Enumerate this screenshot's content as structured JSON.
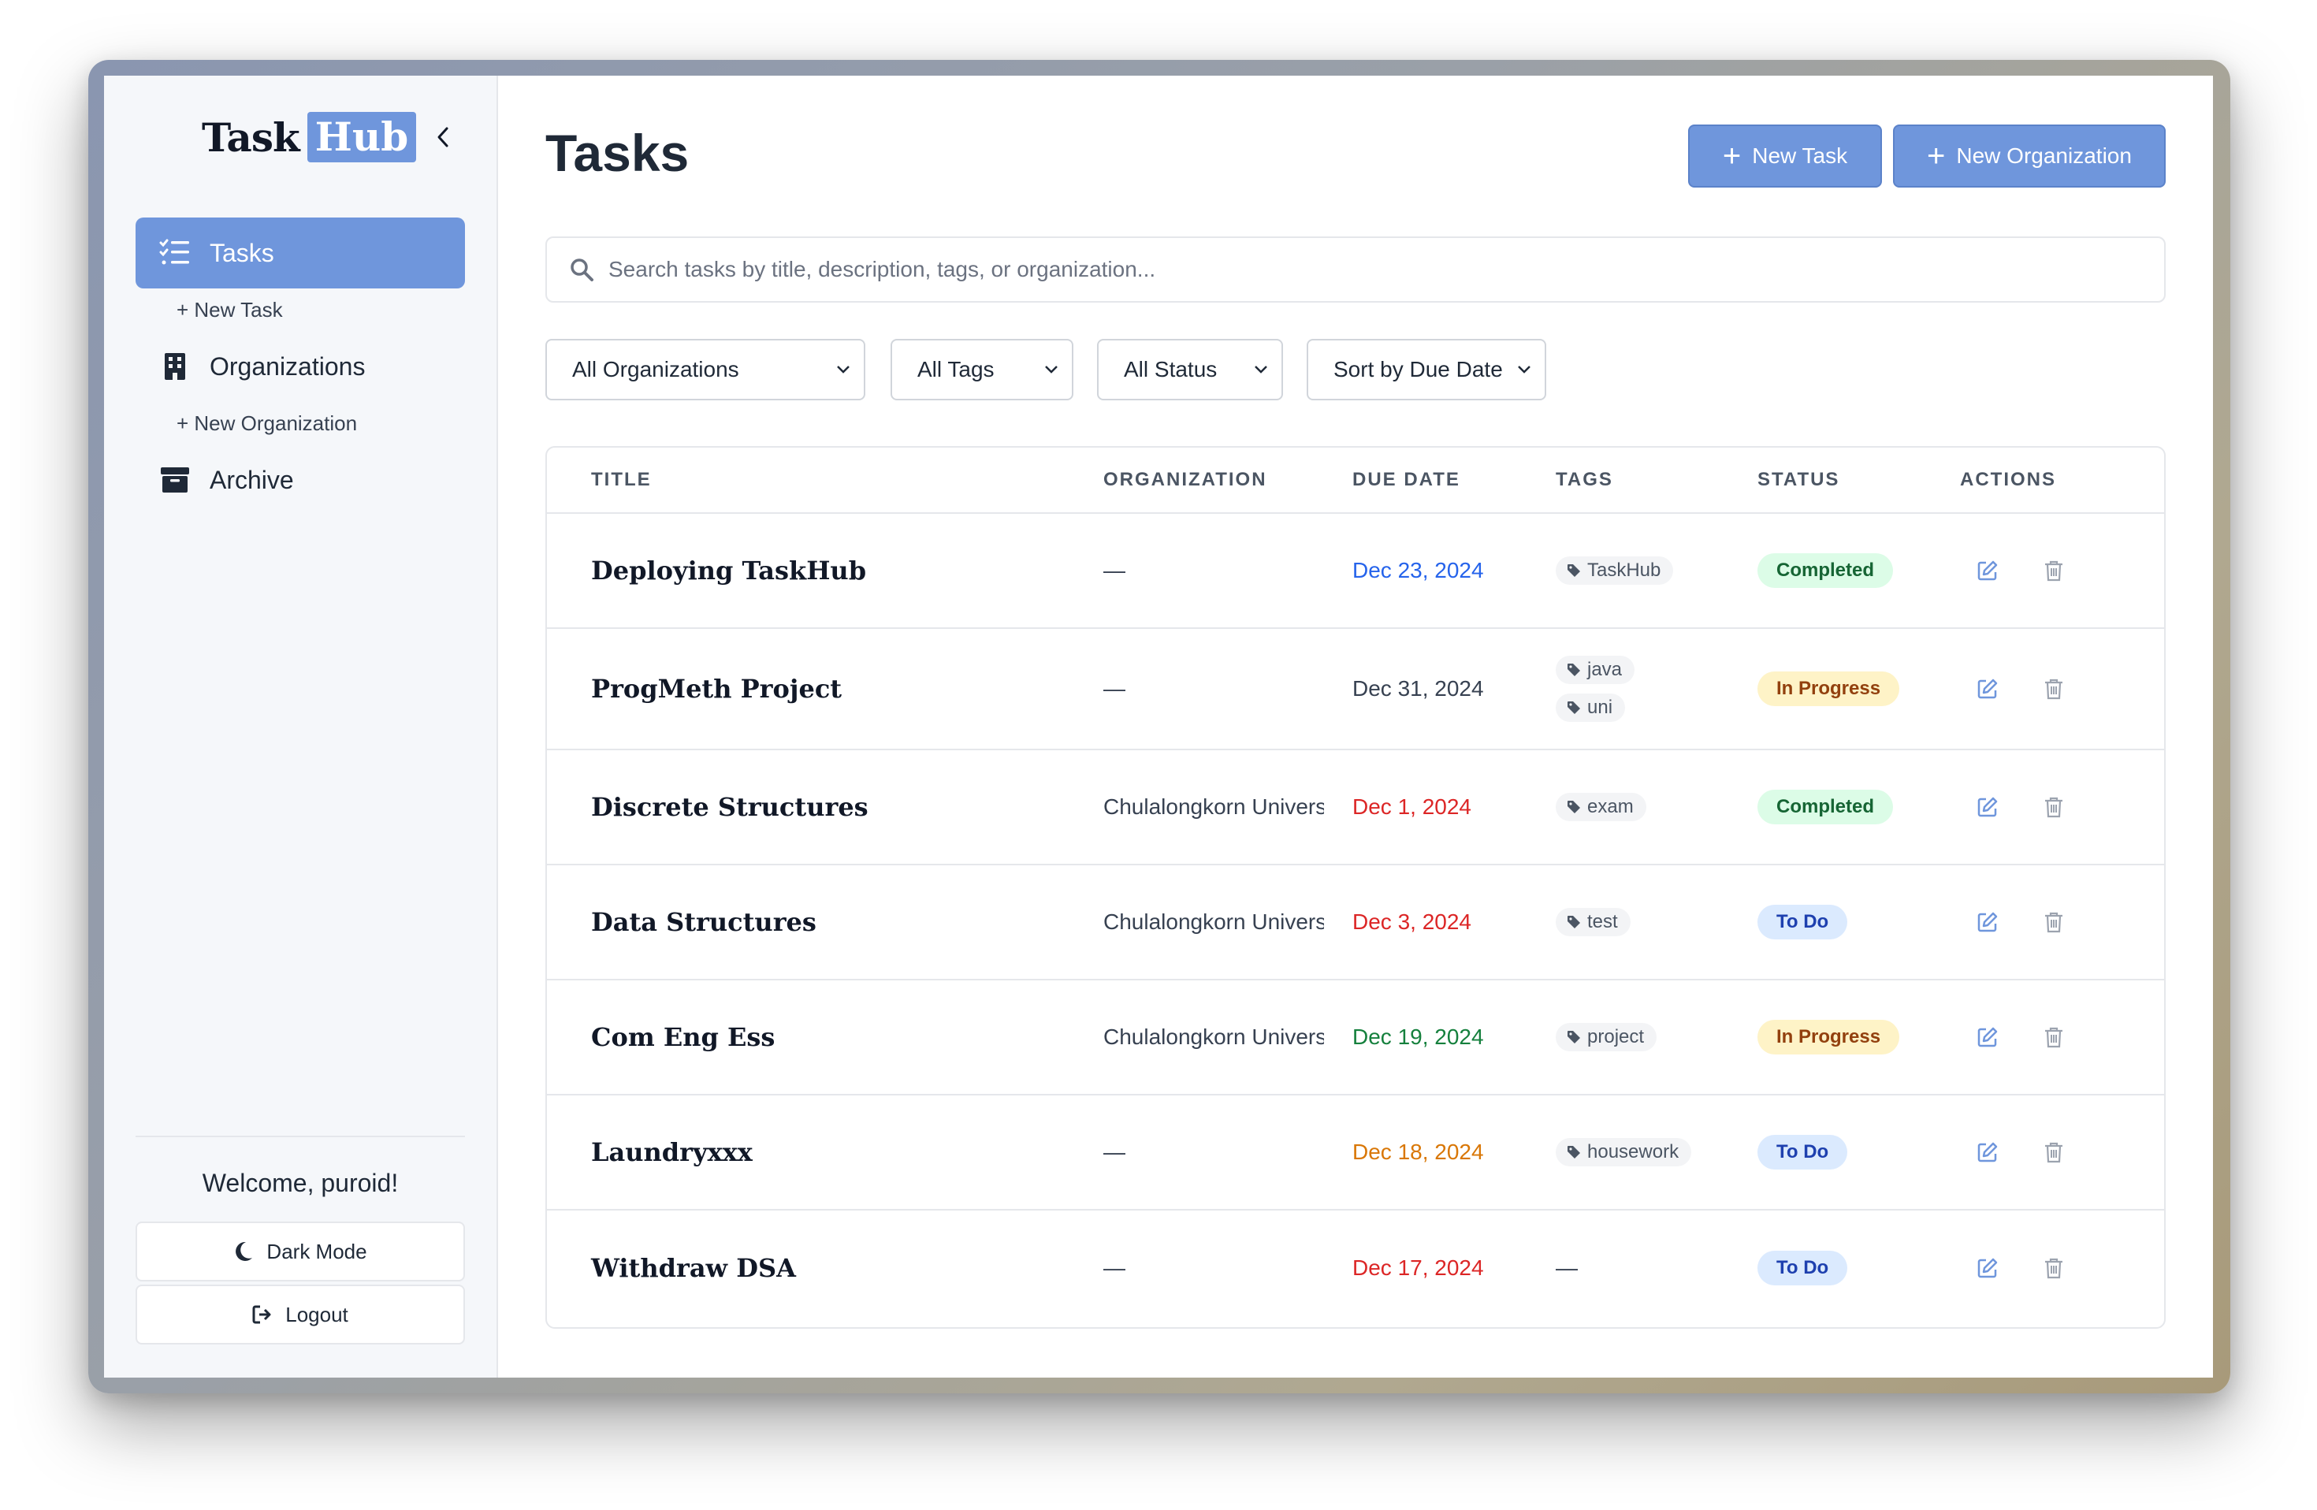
{
  "logo": {
    "part1": "Task",
    "part2": "Hub"
  },
  "sidebar": {
    "items": [
      {
        "label": "Tasks",
        "icon": "list-check-icon",
        "active": true
      },
      {
        "label": "+ New Task",
        "sub": true
      },
      {
        "label": "Organizations",
        "icon": "building-icon"
      },
      {
        "label": "+ New Organization",
        "sub": true
      },
      {
        "label": "Archive",
        "icon": "archive-icon"
      }
    ],
    "welcome": "Welcome, puroid!",
    "dark_mode": "Dark Mode",
    "logout": "Logout"
  },
  "main": {
    "title": "Tasks",
    "new_task": "New Task",
    "new_org": "New Organization",
    "search_placeholder": "Search tasks by title, description, tags, or organization...",
    "filters": [
      "All Organizations",
      "All Tags",
      "All Status",
      "Sort by Due Date"
    ]
  },
  "table": {
    "headers": [
      "TITLE",
      "ORGANIZATION",
      "DUE DATE",
      "TAGS",
      "STATUS",
      "ACTIONS"
    ],
    "rows": [
      {
        "title": "Deploying TaskHub",
        "org": "—",
        "date": "Dec 23, 2024",
        "tags": [
          "TaskHub"
        ],
        "status": "Completed"
      },
      {
        "title": "ProgMeth Project",
        "org": "—",
        "date": "Dec 31, 2024",
        "tags": [
          "java",
          "uni"
        ],
        "status": "In Progress"
      },
      {
        "title": "Discrete Structures",
        "org": "Chulalongkorn Univers",
        "date": "Dec 1, 2024",
        "tags": [
          "exam"
        ],
        "status": "Completed"
      },
      {
        "title": "Data Structures",
        "org": "Chulalongkorn Univers",
        "date": "Dec 3, 2024",
        "tags": [
          "test"
        ],
        "status": "To Do"
      },
      {
        "title": "Com Eng Ess",
        "org": "Chulalongkorn Univers",
        "date": "Dec 19, 2024",
        "tags": [
          "project"
        ],
        "status": "In Progress"
      },
      {
        "title": "Laundryxxx",
        "org": "—",
        "date": "Dec 18, 2024",
        "tags": [
          "housework"
        ],
        "status": "To Do"
      },
      {
        "title": "Withdraw DSA",
        "org": "—",
        "date": "Dec 17, 2024",
        "tags": [],
        "tags_empty": "—",
        "status": "To Do"
      }
    ]
  },
  "colors": {
    "accent": "#6f96dc",
    "date_blue": "#2563eb",
    "date_red": "#dc2626",
    "date_green": "#15803d",
    "date_orange": "#d97706",
    "date_default": "#374151"
  }
}
